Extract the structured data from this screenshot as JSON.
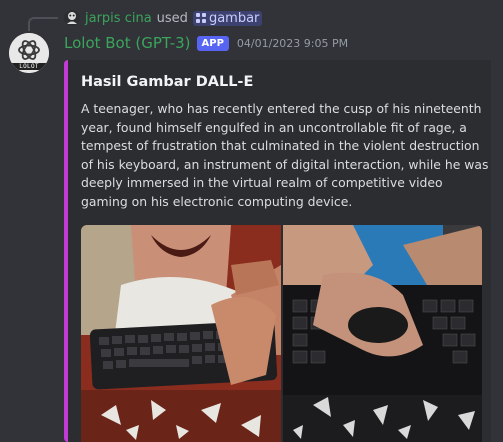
{
  "reply": {
    "username": "jarpis cina",
    "used_text": "used",
    "command": "gambar"
  },
  "message": {
    "bot_name": "Lolot Bot (GPT-3)",
    "badge": "APP",
    "timestamp": "04/01/2023 9:05 PM",
    "avatar_caption": "LOLOT"
  },
  "embed": {
    "title": "Hasil Gambar DALL-E",
    "description": "A teenager, who has recently entered the cusp of his nineteenth year, found himself engulfed in an uncontrollable fit of rage, a tempest of frustration that culminated in the violent destruction of his keyboard, an instrument of digital interaction, while he was deeply immersed in the virtual realm of competitive video gaming on his electronic computing device.",
    "accent_color": "#c33bd6"
  },
  "colors": {
    "background": "#313338",
    "embed_background": "#2b2d31",
    "username_green": "#3ba55c",
    "badge_blurple": "#5865f2"
  }
}
